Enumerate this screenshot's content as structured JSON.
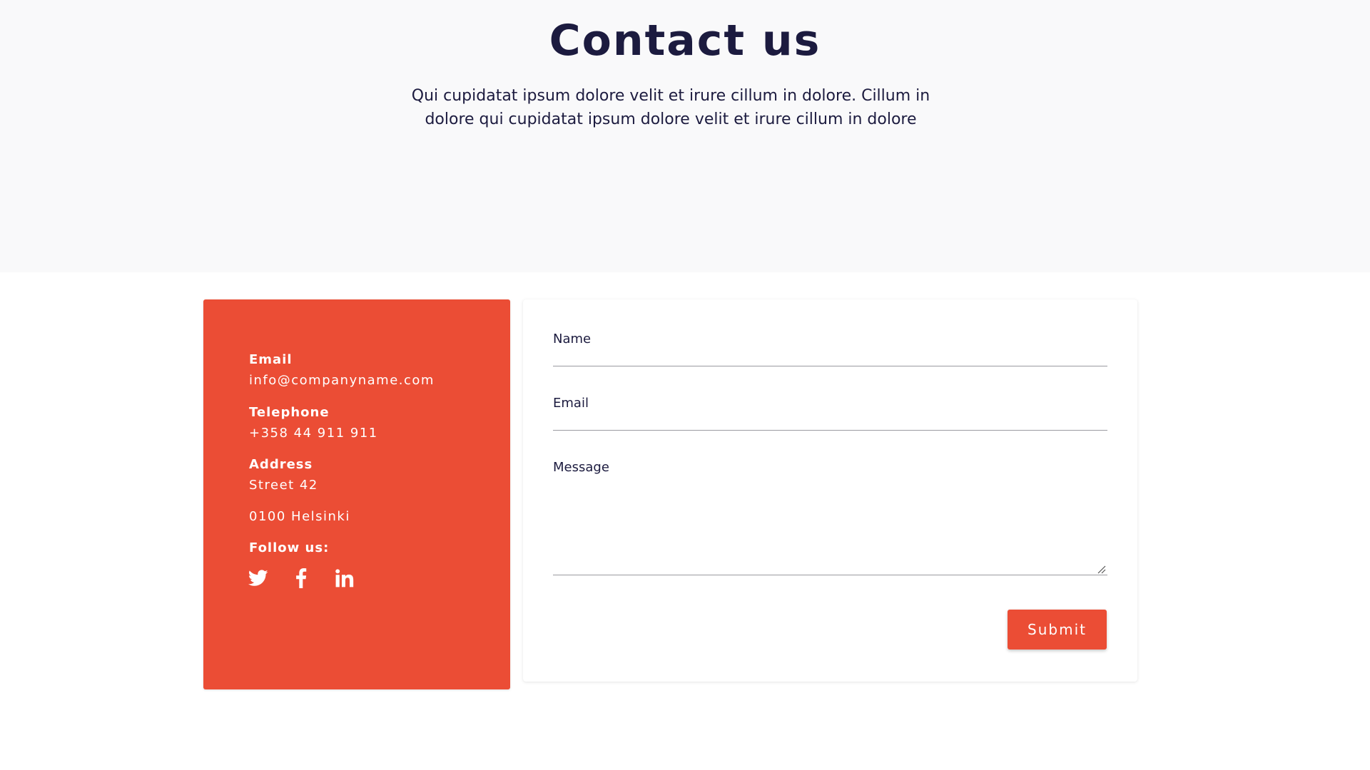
{
  "hero": {
    "title": "Contact us",
    "description": "Qui cupidatat ipsum dolore velit et irure cillum in dolore. Cillum in dolore qui cupidatat ipsum dolore velit et irure cillum in dolore"
  },
  "contact_info": {
    "email_label": "Email",
    "email_value": "info@companyname.com",
    "telephone_label": "Telephone",
    "telephone_value": "+358 44 911 911",
    "address_label": "Address",
    "address_line1": "Street 42",
    "address_line2": "0100 Helsinki",
    "follow_label": "Follow us:",
    "social_icons": [
      "twitter-icon",
      "facebook-icon",
      "linkedin-icon"
    ]
  },
  "form": {
    "name_label": "Name",
    "name_value": "",
    "email_label": "Email",
    "email_value": "",
    "message_label": "Message",
    "message_value": "",
    "submit_label": "Submit"
  },
  "colors": {
    "accent": "#eb4d35",
    "heading": "#1c1b3f",
    "hero_background": "#f9f9fa"
  }
}
